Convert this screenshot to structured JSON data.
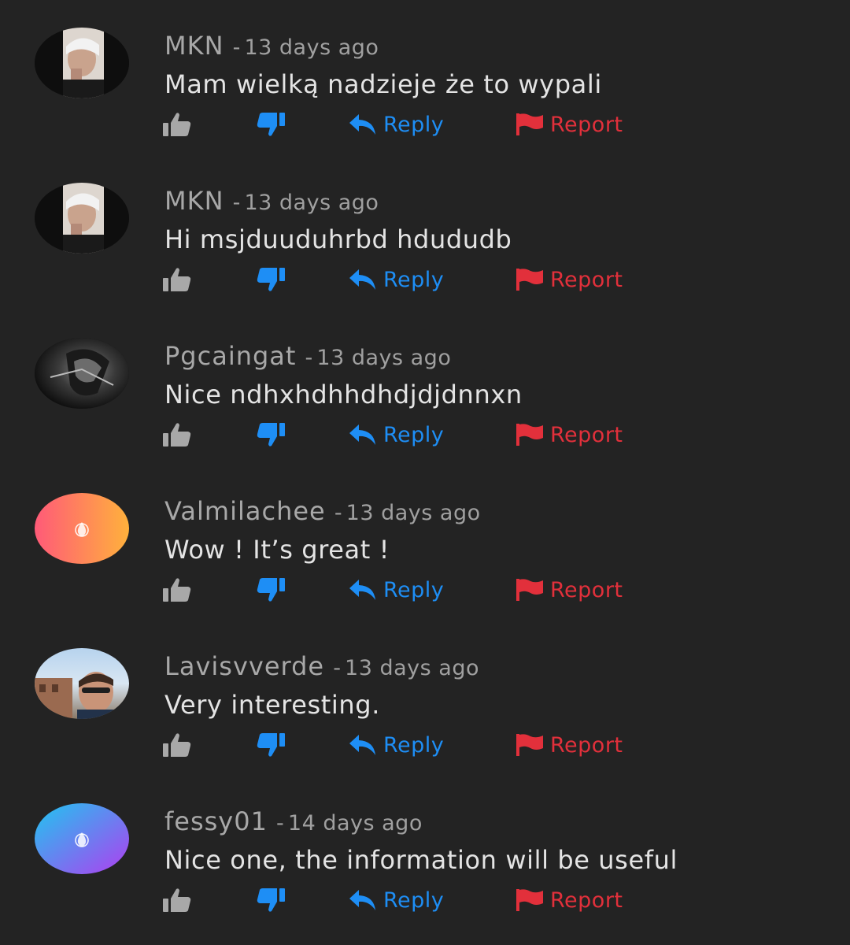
{
  "colors": {
    "background": "#232323",
    "reply_accent": "#1e8ef5",
    "report_accent": "#e2303b",
    "like_icon": "#a8a8a8",
    "dislike_icon": "#1e8ef5"
  },
  "actions": {
    "reply_label": "Reply",
    "report_label": "Report"
  },
  "comments": [
    {
      "author": "MKN",
      "separator": "-",
      "time": "13 days ago",
      "text": "Mam wielką nadzieje że to wypali",
      "avatar": "photo-avatar"
    },
    {
      "author": "MKN",
      "separator": "-",
      "time": "13 days ago",
      "text": "Hi msjduuduhrbd hdududb",
      "avatar": "photo-avatar"
    },
    {
      "author": "Pgcaingat",
      "separator": "-",
      "time": "13 days ago",
      "text": "Nice ndhxhdhhdhdjdjdnnxn",
      "avatar": "photo-avatar"
    },
    {
      "author": "Valmilachee",
      "separator": "-",
      "time": "13 days ago",
      "text": "Wow ! It’s great !",
      "avatar": "gradient-drop-avatar"
    },
    {
      "author": "Lavisvverde",
      "separator": "-",
      "time": "13 days ago",
      "text": "Very interesting.",
      "avatar": "photo-avatar"
    },
    {
      "author": "fessy01",
      "separator": "-",
      "time": "14 days ago",
      "text": "Nice one, the information will be useful",
      "avatar": "gradient-drop-avatar"
    }
  ]
}
